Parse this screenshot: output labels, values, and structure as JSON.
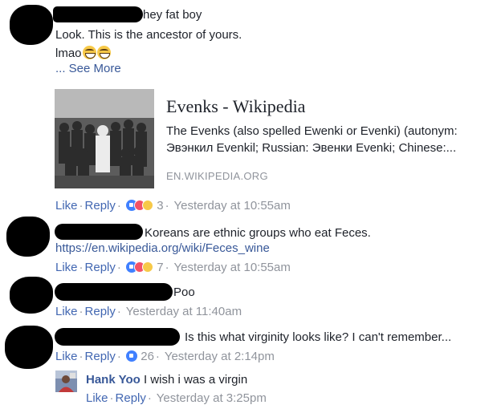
{
  "comments": [
    {
      "text_lines": [
        "hey fat boy",
        "Look. This is the ancestor of yours.",
        "lmao"
      ],
      "see_more": "... See More",
      "link_card": {
        "title": "Evenks - Wikipedia",
        "description_lines": [
          "The Evenks (also spelled Ewenki or Evenki) (autonym:",
          "Эвэнкил Evenkil; Russian: Эвенки Evenki; Chinese:..."
        ],
        "domain": "EN.WIKIPEDIA.ORG"
      },
      "like_label": "Like",
      "reply_label": "Reply",
      "reaction_count": "3",
      "timestamp": "Yesterday at 10:55am"
    },
    {
      "text_lines": [
        "Koreans are ethnic groups who eat Feces."
      ],
      "link_text": "https://en.wikipedia.org/wiki/Feces_wine",
      "like_label": "Like",
      "reply_label": "Reply",
      "reaction_count": "7",
      "timestamp": "Yesterday at 10:55am"
    },
    {
      "text_lines": [
        "Poo"
      ],
      "like_label": "Like",
      "reply_label": "Reply",
      "timestamp": "Yesterday at 11:40am"
    },
    {
      "text_lines": [
        "Is this what virginity looks like? I can't remember..."
      ],
      "like_label": "Like",
      "reply_label": "Reply",
      "reaction_count": "26",
      "timestamp": "Yesterday at 2:14pm"
    }
  ],
  "reply": {
    "author": "Hank Yoo",
    "text": "I wish i was a virgin",
    "like_label": "Like",
    "reply_label": "Reply",
    "timestamp": "Yesterday at 3:25pm"
  },
  "colors": {
    "link": "#4267b2",
    "meta_gray": "#90949c",
    "text": "#1d2129"
  }
}
